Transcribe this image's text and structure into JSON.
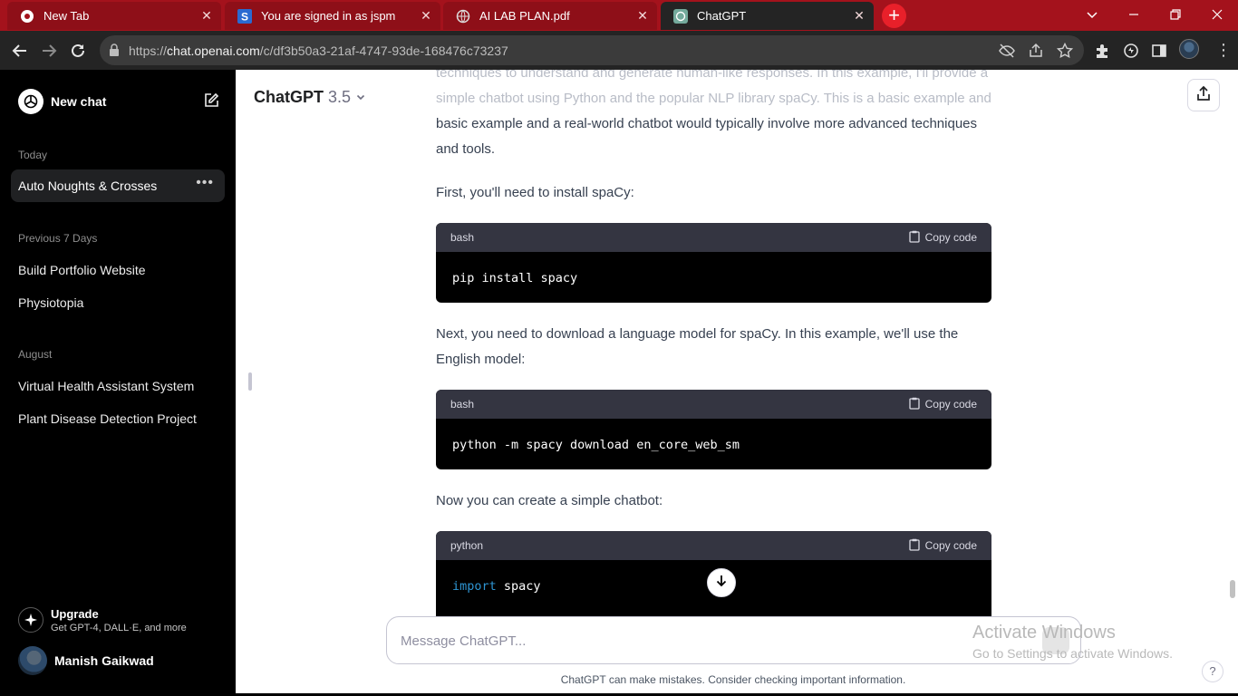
{
  "browser": {
    "tabs": [
      {
        "title": "New Tab",
        "icon": "chrome-icon"
      },
      {
        "title": "You are signed in as jspm",
        "icon": "s-favicon"
      },
      {
        "title": "AI LAB PLAN.pdf",
        "icon": "globe-icon"
      },
      {
        "title": "ChatGPT",
        "icon": "openai-icon"
      }
    ],
    "url_prefix": "https://",
    "url_domain": "chat.openai.com",
    "url_path": "/c/df3b50a3-21af-4747-93de-168476c73237",
    "new_tab_symbol": "+",
    "close_symbol": "✕",
    "accent": "#a4121c"
  },
  "sidebar": {
    "new_chat": "New chat",
    "sections": [
      {
        "label": "Today",
        "items": [
          "Auto Noughts & Crosses"
        ]
      },
      {
        "label": "Previous 7 Days",
        "items": [
          "Build Portfolio Website",
          "Physiotopia"
        ]
      },
      {
        "label": "August",
        "items": [
          "Virtual Health Assistant System",
          "Plant Disease Detection Project"
        ]
      }
    ],
    "more_symbol": "•••",
    "upgrade_title": "Upgrade",
    "upgrade_subtitle": "Get GPT-4, DALL·E, and more",
    "user_name": "Manish Gaikwad"
  },
  "header": {
    "model": "ChatGPT",
    "version": "3.5"
  },
  "message": {
    "faded_text": "techniques to understand and generate human-like responses. In this example, I'll provide a simple chatbot using Python and the popular NLP library spaCy. This is a basic example and a real-world chatbot would typically involve more advanced techniques and tools.",
    "line_tail": "basic example and a real-world chatbot would typically involve more advanced techniques and tools.",
    "para_install": "First, you'll need to install spaCy:",
    "para_model": "Next, you need to download a language model for spaCy. In this example, we'll use the English model:",
    "para_create": "Now you can create a simple chatbot:",
    "copy_label": "Copy code",
    "code_blocks": [
      {
        "lang": "bash",
        "code": "pip install spacy"
      },
      {
        "lang": "bash",
        "code": "python -m spacy download en_core_web_sm"
      },
      {
        "lang": "python",
        "code_keyword": "import",
        "code_rest": " spacy"
      }
    ]
  },
  "composer": {
    "placeholder": "Message ChatGPT..."
  },
  "footer": {
    "disclaimer": "ChatGPT can make mistakes. Consider checking important information.",
    "help": "?"
  },
  "watermark": {
    "line1": "Activate Windows",
    "line2": "Go to Settings to activate Windows."
  }
}
